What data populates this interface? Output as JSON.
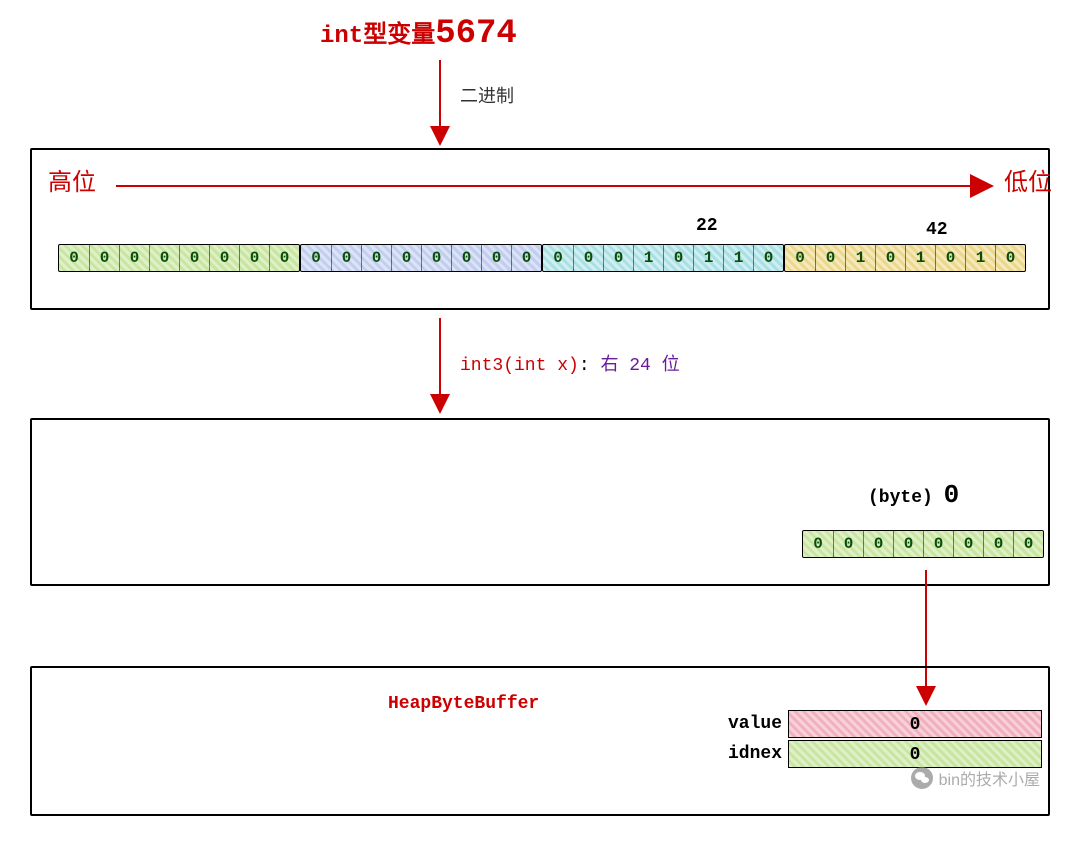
{
  "title_prefix": "int型变量",
  "title_value": "5674",
  "binary_label": "二进制",
  "high_label": "高位",
  "low_label": "低位",
  "byte_label_22": "22",
  "byte_label_42": "42",
  "bytes": {
    "b3": [
      "0",
      "0",
      "0",
      "0",
      "0",
      "0",
      "0",
      "0"
    ],
    "b2": [
      "0",
      "0",
      "0",
      "0",
      "0",
      "0",
      "0",
      "0"
    ],
    "b1": [
      "0",
      "0",
      "0",
      "1",
      "0",
      "1",
      "1",
      "0"
    ],
    "b0": [
      "0",
      "0",
      "1",
      "0",
      "1",
      "0",
      "1",
      "0"
    ]
  },
  "op_label_red": "int3(int x)",
  "op_label_colon": ":",
  "op_label_purple": "右 24 位",
  "cast_label": "(byte)",
  "cast_value": "0",
  "result_byte": [
    "0",
    "0",
    "0",
    "0",
    "0",
    "0",
    "0",
    "0"
  ],
  "heap_label": "HeapByteBuffer",
  "table": {
    "value_label": "value",
    "value_val": "0",
    "index_label": "idnex",
    "index_val": "0"
  },
  "watermark": "bin的技术小屋"
}
